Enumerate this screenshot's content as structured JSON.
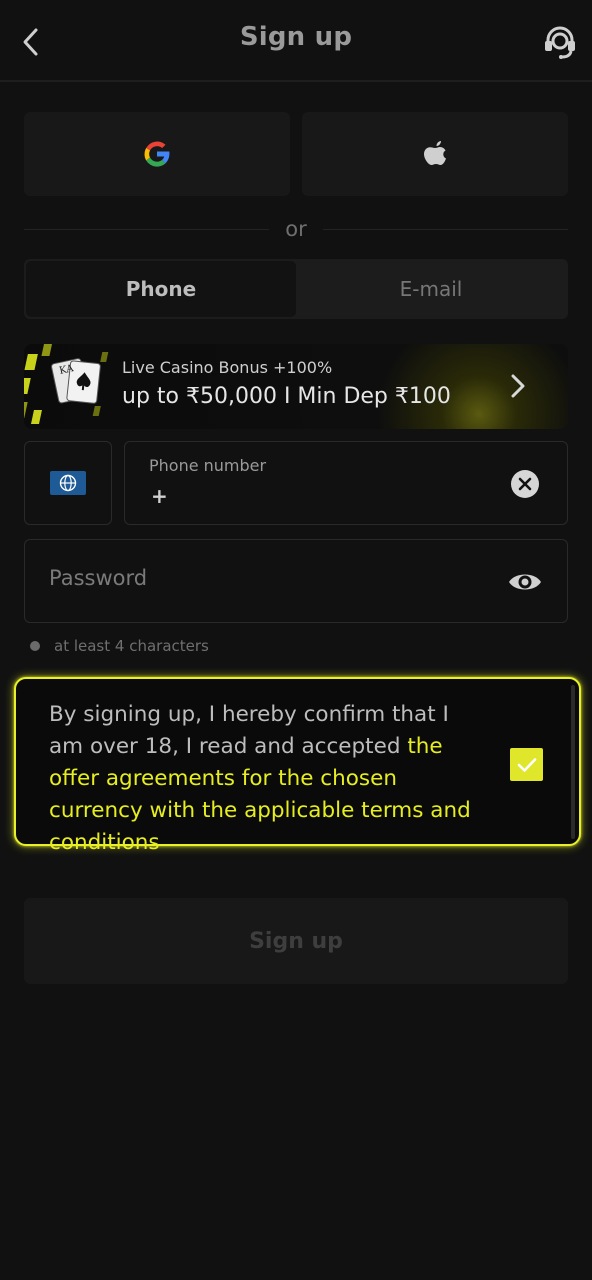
{
  "header": {
    "title": "Sign up",
    "back_icon": "chevron-left-icon",
    "support_icon": "headset-icon"
  },
  "social": {
    "google_icon": "google-icon",
    "apple_icon": "apple-icon"
  },
  "divider_text": "or",
  "tabs": [
    {
      "label": "Phone",
      "active": true
    },
    {
      "label": "E-mail",
      "active": false
    }
  ],
  "promo": {
    "line1": "Live Casino Bonus +100%",
    "line2": "up to ₹50,000 I Min Dep ₹100",
    "card_letters": "KA"
  },
  "phone": {
    "label": "Phone number",
    "value": "+",
    "country_icon": "globe-icon"
  },
  "password": {
    "placeholder": "Password"
  },
  "hint": "at least 4 characters",
  "consent": {
    "text_start": "By signing up, I hereby confirm that I am over 18, I read and accepted ",
    "link_text": "the offer agreements for the chosen currency with the applicable terms and conditions",
    "checked": true
  },
  "submit_label": "Sign up",
  "colors": {
    "accent": "#e6ee1f",
    "background": "#111111"
  }
}
